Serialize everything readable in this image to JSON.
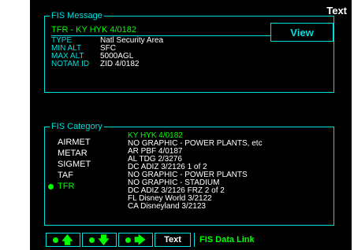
{
  "corner_label": "Text",
  "fis_message": {
    "panel_title": "FIS Message",
    "title": "TFR - KY HYK 4/0182",
    "view_label": "View",
    "rows": [
      {
        "label": "TYPE",
        "value": "Natl Security Area"
      },
      {
        "label": "MIN ALT",
        "value": "SFC"
      },
      {
        "label": "MAX ALT",
        "value": "5000AGL"
      },
      {
        "label": "NOTAM ID",
        "value": "ZID 4/0182"
      }
    ]
  },
  "fis_category": {
    "panel_title": "FIS Category",
    "categories": [
      "AIRMET",
      "METAR",
      "SIGMET",
      "TAF",
      "TFR"
    ],
    "selected": "TFR",
    "details": [
      "KY HYK 4/0182",
      "NO GRAPHIC - POWER PLANTS, etc",
      "AR PBF 4/0187",
      "AL TDG 2/3276",
      "DC ADIZ 3/2126  1 of 2",
      "NO GRAPHIC - POWER PLANTS",
      "NO GRAPHIC - STADIUM",
      "DC ADIZ 3/2126 FRZ  2 of 2",
      "FL Disney World 3/2122",
      "CA Disneyland 3/2123"
    ]
  },
  "softkeys": {
    "up_icon": "arrow-up-icon",
    "down_icon": "arrow-down-icon",
    "right_icon": "arrow-right-icon",
    "text_label": "Text",
    "mode_label": "FIS Data Link"
  }
}
